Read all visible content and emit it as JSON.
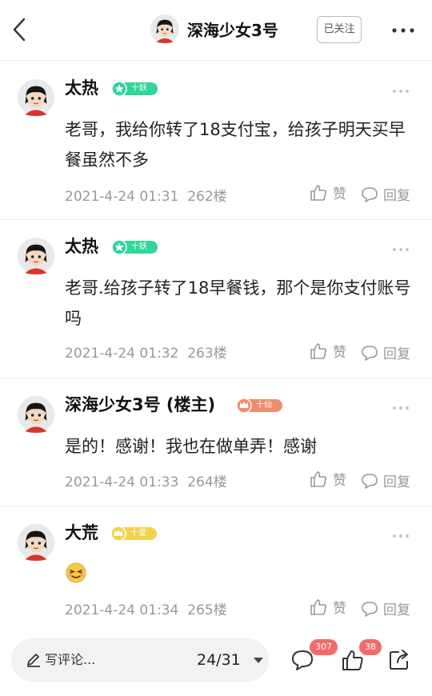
{
  "header": {
    "title": "深海少女3号",
    "follow_label": "已关注"
  },
  "posts": [
    {
      "author": "太热",
      "badge": "十妖",
      "badge_color": "#30d59a",
      "content": "老哥，我给你转了18支付宝，给孩子明天买早餐虽然不多",
      "time": "2021-4-24 01:31",
      "floor": "262楼",
      "like_label": "赞",
      "reply_label": "回复"
    },
    {
      "author": "太热",
      "badge": "十妖",
      "badge_color": "#30d59a",
      "content": "老哥.给孩子转了18早餐钱，那个是你支付账号吗",
      "time": "2021-4-24 01:32",
      "floor": "263楼",
      "like_label": "赞",
      "reply_label": "回复"
    },
    {
      "author": "深海少女3号 (楼主)",
      "badge": "十仙",
      "badge_color": "#f08c6c",
      "content": "是的！感谢！我也在做单弄！感谢",
      "time": "2021-4-24 01:33",
      "floor": "264楼",
      "like_label": "赞",
      "reply_label": "回复"
    },
    {
      "author": "大荒",
      "badge": "十皇",
      "badge_color": "#f2d24c",
      "content": "",
      "emoji": "smirk-emoji",
      "time": "2021-4-24 01:34",
      "floor": "265楼",
      "like_label": "赞",
      "reply_label": "回复"
    }
  ],
  "bottom_bar": {
    "write_label": "写评论...",
    "page_count": "24/31",
    "comment_count": "307",
    "like_count": "38"
  },
  "icons": [
    "back-icon",
    "more-icon",
    "thumb-up-icon",
    "comment-icon",
    "pen-icon",
    "share-icon",
    "caret-down-icon"
  ],
  "colors": {
    "badge_green": "#30d59a",
    "badge_orange": "#f08c6c",
    "badge_yellow": "#f2d24c",
    "count_badge": "#f26a6a"
  }
}
